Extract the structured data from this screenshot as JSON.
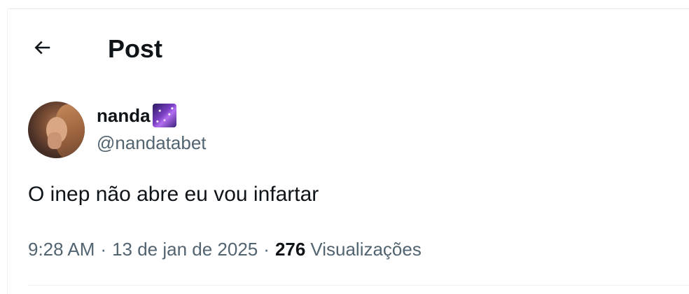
{
  "header": {
    "back_icon": "arrow-left-icon",
    "title": "Post"
  },
  "post": {
    "author": {
      "display_name": "nanda",
      "name_emoji": "milky-way-emoji",
      "username": "@nandatabet"
    },
    "text": "O inep não abre eu vou infartar",
    "meta": {
      "time": "9:28 AM",
      "separator": "·",
      "date": "13 de jan de 2025",
      "views_count": "276",
      "views_label": "Visualizações"
    }
  },
  "colors": {
    "primary_text": "#0f1419",
    "secondary_text": "#536471",
    "divider": "#eff3f4"
  }
}
